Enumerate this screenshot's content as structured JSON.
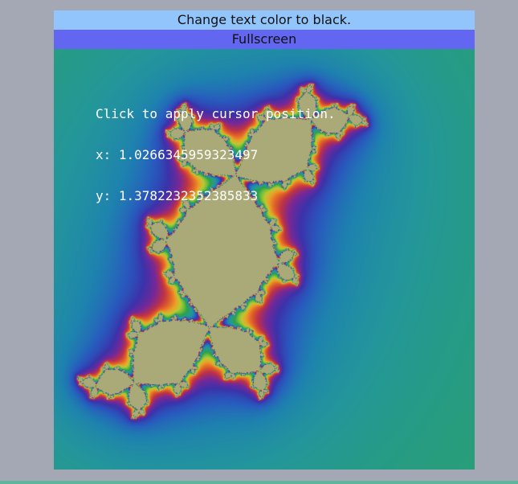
{
  "toolbar": {
    "color_button_label": "Change text color to black.",
    "fullscreen_button_label": "Fullscreen"
  },
  "overlay": {
    "hint": "Click to apply cursor position.",
    "x_readout": "x: 1.0266345959323497",
    "y_readout": "y: 1.3782232352385833"
  },
  "colors": {
    "page_background": "#a3a8b4",
    "color_button_bg": "#93c5fd",
    "fullscreen_button_bg": "#6366f1",
    "overlay_text": "#ffffff",
    "bottom_strip": "#5fb59a"
  },
  "icons": []
}
